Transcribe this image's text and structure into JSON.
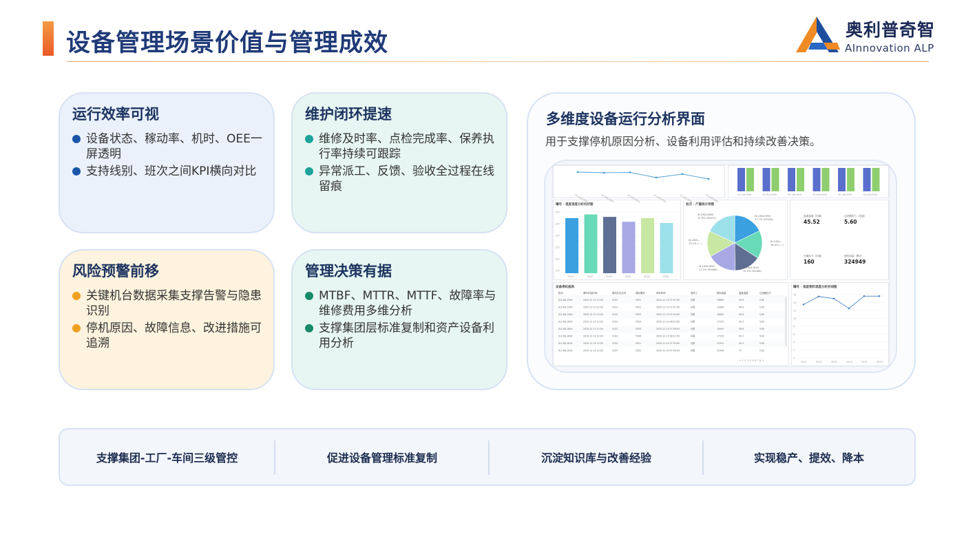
{
  "header": {
    "title": "设备管理场景价值与管理成效",
    "logo_cn": "奥利普奇智",
    "logo_en": "AInnovation ALP",
    "logo_icon": "triangle-logo-icon"
  },
  "cards": [
    {
      "title": "运行效率可视",
      "bullets": [
        "设备状态、稼动率、机时、OEE一屏透明",
        "支持线别、班次之间KPI横向对比"
      ],
      "dot_color": "#1a56a8"
    },
    {
      "title": "维护闭环提速",
      "bullets": [
        "维修及时率、点检完成率、保养执行率持续可跟踪",
        "异常派工、反馈、验收全过程在线留痕"
      ],
      "dot_color": "#1fa29a"
    },
    {
      "title": "风险预警前移",
      "bullets": [
        "关键机台数据采集支撑告警与隐患识别",
        "停机原因、故障信息、改进措施可追溯"
      ],
      "dot_color": "#f0a020"
    },
    {
      "title": "管理决策有据",
      "bullets": [
        "MTBF、MTTR、MTTF、故障率与维修费用多维分析",
        "支撑集团层标准复制和资产设备利用分析"
      ],
      "dot_color": "#178a6a"
    }
  ],
  "panel": {
    "title": "多维度设备运行分析界面",
    "subtitle": "用于支撑停机原因分析、设备利用评估和持续改善决策。",
    "dashboard": {
      "panel_titles": [
        "罐号 - 温度温度分析柱状图",
        "批次 - 产量统计饼图",
        "设备停机报表",
        "罐号 - 温度物料温度分析折线图"
      ],
      "kpis": [
        {
          "label": "温度温度（均值）",
          "value": "45.52"
        },
        {
          "label": "过滤器压力（均值）",
          "value": "5.60"
        },
        {
          "label": "均值压力（均值）",
          "value": "160"
        },
        {
          "label": "原料用量（累计）",
          "value": "324949"
        }
      ],
      "top_line_values": [
        5.2,
        5.0,
        5.1,
        3.6,
        4.6,
        3.2
      ],
      "top_line_labels": [
        "0L14QL159A",
        "0L14QL160A",
        "0L14QL161A",
        "0L14QL162A",
        "0L14QL163A",
        "0L14QL164A"
      ],
      "grouped_bar_labels": [
        "0L14QL159A",
        "0L14QL160A",
        "0L14QL161A",
        "0L14QL162A",
        "0L14QL163A",
        "0L14QL164A"
      ],
      "grouped_bar_values": [
        [
          8,
          8
        ],
        [
          8,
          8
        ],
        [
          8,
          8
        ],
        [
          8,
          8
        ],
        [
          8,
          8
        ],
        [
          8,
          8
        ]
      ],
      "bar_categories": [
        "5501",
        "5502",
        "5503",
        "5504",
        "5505",
        "5506"
      ],
      "bar_values": [
        137.5,
        139,
        138,
        136,
        137.5,
        135.5
      ],
      "bar_colors": [
        "#3aa0e0",
        "#68dab8",
        "#5f6e93",
        "#a7a8e4",
        "#c7e7a2",
        "#9ce0ea"
      ],
      "bar_yticks": [
        "140",
        "135",
        "130",
        "125",
        "120",
        "115"
      ],
      "pie_labels": [
        "0L14QL159A\n17.7% (51543)",
        "0L14QL164A\n17.9% (55471)",
        "0L14QL...\n16.4% (...)",
        "0L14QL161A\n15.5% (50284)",
        "0L14QL162A\n17.1% (55484)",
        "0L14QL...\n15.1% (...)"
      ],
      "pie_values": [
        17.7,
        16.4,
        15.5,
        17.1,
        15.1,
        17.9
      ],
      "pie_colors": [
        "#3aa0e0",
        "#68dab8",
        "#5f6e93",
        "#a7a8e4",
        "#c7e7a2",
        "#9ce0ea"
      ],
      "table_headers": [
        "批次",
        "原料开始时间",
        "原料打出仓号",
        "储存罐号",
        "停料时间",
        "操作工",
        "原料用量",
        "温度温度",
        "过滤器压力"
      ],
      "table_rows": [
        [
          "0L14QL159A",
          "2020-12-13 12:00",
          "0103",
          "5501",
          "2020-12-13 07:41:00",
          "孙勇",
          "19695",
          "45.6",
          "5.60"
        ],
        [
          "0L14QL159A",
          "2020-12-13 12:00",
          "0103",
          "5502",
          "2020-12-13 07:07:00",
          "孙勇",
          "19466",
          "46.4",
          "5.60"
        ],
        [
          "0L14QL159A",
          "2020-12-13 12:00",
          "0103",
          "5503",
          "2020-12-13 07:40:00",
          "孙勇",
          "18400",
          "45.6",
          "5.60"
        ],
        [
          "0L14QL160A",
          "2020-12-13 12:00",
          "0103",
          "5504",
          "2020-12-13 08:23:00",
          "孙勇",
          "17235",
          "45.5",
          "5.60"
        ],
        [
          "0L14QL160A",
          "2020-12-13 12:00",
          "0103",
          "5505",
          "2020-12-13 07:56:00",
          "孙勇",
          "19494",
          "46.6",
          "5.60"
        ],
        [
          "0L14QL160A",
          "2020-12-13 12:00",
          "0103",
          "5506",
          "2020-12-13 08:11:00",
          "孙勇",
          "17150",
          "45.3",
          "5.60"
        ],
        [
          "0L14QL161A",
          "2020-12-14 12:00",
          "0104",
          "5501",
          "2020-12-14 07:53:00",
          "孙勇",
          "15341",
          "45.2",
          "5.60"
        ],
        [
          "0L14QL161A",
          "2020-12-14 12:00",
          "0104",
          "5502",
          "2020-12-14 07:48:00",
          "孙勇",
          "15346",
          "47",
          "5.60"
        ]
      ],
      "pager": "< 1 2 3 4 5 6 7 8 >",
      "line_values": [
        13.5,
        15.5,
        15,
        12.5,
        15.6,
        15.6
      ],
      "line_categories": [
        "5501",
        "5502",
        "5503",
        "5504",
        "5505",
        "5506"
      ],
      "line_yticks": [
        "16",
        "14",
        "12",
        "10",
        "8",
        "6",
        "4",
        "2",
        "0"
      ]
    }
  },
  "bottom_bar": [
    "支撑集团-工厂-车间三级管控",
    "促进设备管理标准复制",
    "沉淀知识库与改善经验",
    "实现稳产、提效、降本"
  ]
}
